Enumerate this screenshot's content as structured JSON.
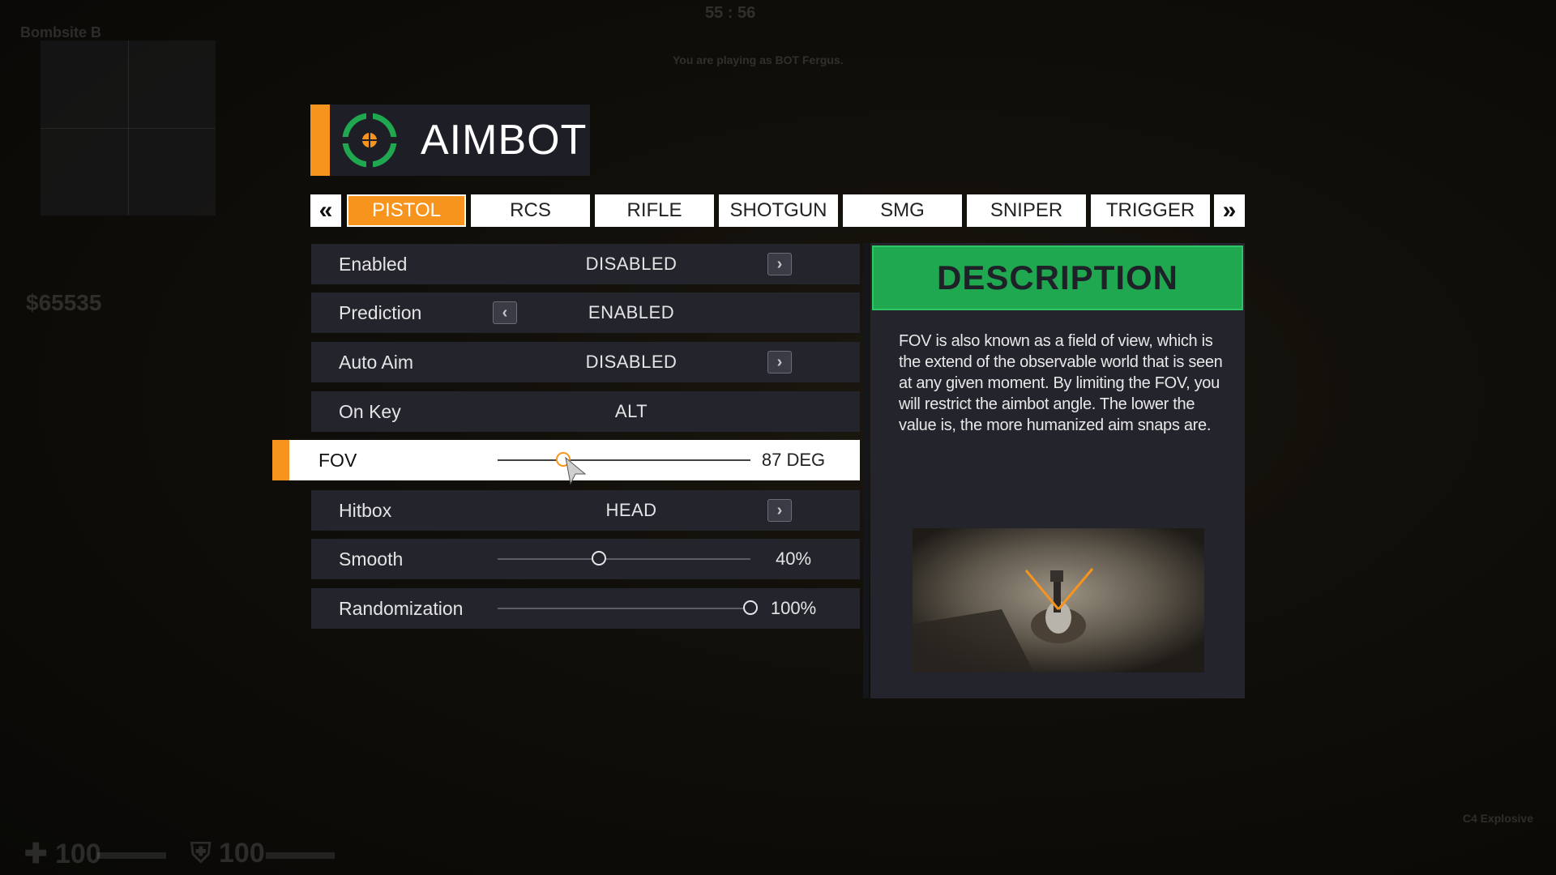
{
  "header": {
    "title": "AIMBOT"
  },
  "tabs": {
    "prev_icon": "«",
    "next_icon": "»",
    "items": [
      {
        "label": "PISTOL",
        "active": true
      },
      {
        "label": "RCS"
      },
      {
        "label": "RIFLE"
      },
      {
        "label": "SHOTGUN"
      },
      {
        "label": "SMG"
      },
      {
        "label": "SNIPER"
      },
      {
        "label": "TRIGGER"
      }
    ]
  },
  "settings": {
    "enabled": {
      "label": "Enabled",
      "value": "DISABLED"
    },
    "prediction": {
      "label": "Prediction",
      "value": "ENABLED"
    },
    "auto_aim": {
      "label": "Auto Aim",
      "value": "DISABLED"
    },
    "on_key": {
      "label": "On Key",
      "value": "ALT"
    },
    "fov": {
      "label": "FOV",
      "value": "87 DEG",
      "level": 0.26
    },
    "hitbox": {
      "label": "Hitbox",
      "value": "HEAD"
    },
    "smooth": {
      "label": "Smooth",
      "value": "40%",
      "level": 0.4
    },
    "randomization": {
      "label": "Randomization",
      "value": "100%",
      "level": 1.0
    }
  },
  "description": {
    "title": "DESCRIPTION",
    "text": "FOV is also known as a field of view, which is the extend of the observable world that is seen at any given moment. By limiting the FOV, you will restrict the aimbot angle. The lower the value is, the more humanized aim snaps are."
  },
  "hud": {
    "radar_label": "Bombsite B",
    "money": "$65535",
    "health": "100",
    "armor": "100",
    "score": "55 : 56",
    "playing_as": "You are playing as BOT Fergus.",
    "explosive": "C4 Explosive"
  },
  "colors": {
    "accent": "#f7941d",
    "panel": "#23242c",
    "description_header": "#1fa84f"
  }
}
